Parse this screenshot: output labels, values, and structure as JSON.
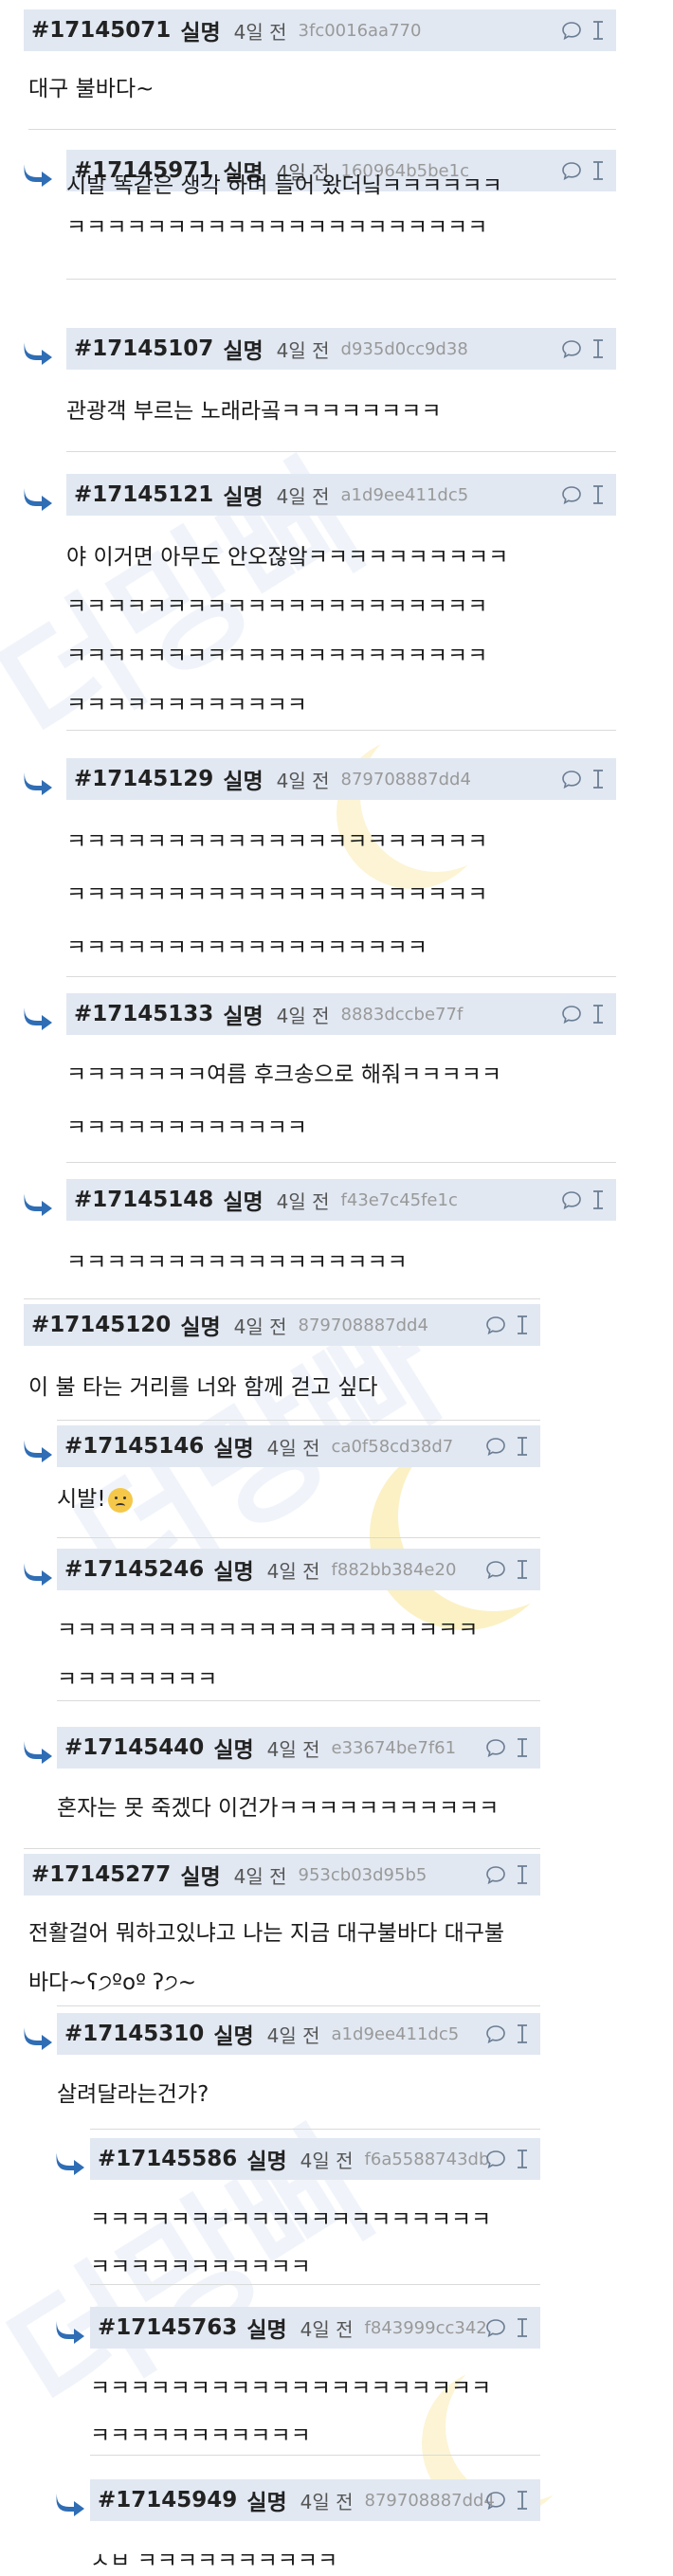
{
  "comments": [
    {
      "id": "#17145071",
      "author": "실명",
      "date": "4일 전",
      "hash": "3fc0016aa770",
      "lines": [
        "대구 불바다~"
      ]
    },
    {
      "id": "#17145971",
      "author": "실명",
      "date": "4일 전",
      "hash": "160964b5be1c",
      "lines": [
        "시발 똑같은 생각 하며 들어 왔더닠ㅋㅋㅋㅋㅋㅋ",
        "ㅋㅋㅋㅋㅋㅋㅋㅋㅋㅋㅋㅋㅋㅋㅋㅋㅋㅋㅋㅋㅋ"
      ]
    },
    {
      "id": "#17145107",
      "author": "실명",
      "date": "4일 전",
      "hash": "d935d0cc9d38",
      "lines": [
        "관광객 부르는 노래라곸ㅋㅋㅋㅋㅋㅋㅋㅋ"
      ]
    },
    {
      "id": "#17145121",
      "author": "실명",
      "date": "4일 전",
      "hash": "a1d9ee411dc5",
      "lines": [
        "야 이거면 아무도 안오잖앜ㅋㅋㅋㅋㅋㅋㅋㅋㅋㅋ",
        "ㅋㅋㅋㅋㅋㅋㅋㅋㅋㅋㅋㅋㅋㅋㅋㅋㅋㅋㅋㅋㅋ",
        "ㅋㅋㅋㅋㅋㅋㅋㅋㅋㅋㅋㅋㅋㅋㅋㅋㅋㅋㅋㅋㅋ",
        "ㅋㅋㅋㅋㅋㅋㅋㅋㅋㅋㅋㅋ"
      ]
    },
    {
      "id": "#17145129",
      "author": "실명",
      "date": "4일 전",
      "hash": "879708887dd4",
      "lines": [
        "ㅋㅋㅋㅋㅋㅋㅋㅋㅋㅋㅋㅋㅋㅋㅋㅋㅋㅋㅋㅋㅋ",
        "ㅋㅋㅋㅋㅋㅋㅋㅋㅋㅋㅋㅋㅋㅋㅋㅋㅋㅋㅋㅋㅋ",
        "ㅋㅋㅋㅋㅋㅋㅋㅋㅋㅋㅋㅋㅋㅋㅋㅋㅋㅋ"
      ]
    },
    {
      "id": "#17145133",
      "author": "실명",
      "date": "4일 전",
      "hash": "8883dccbe77f",
      "lines": [
        "ㅋㅋㅋㅋㅋㅋㅋ여름 후크송으로 해줘ㅋㅋㅋㅋㅋ",
        "ㅋㅋㅋㅋㅋㅋㅋㅋㅋㅋㅋㅋ"
      ]
    },
    {
      "id": "#17145148",
      "author": "실명",
      "date": "4일 전",
      "hash": "f43e7c45fe1c",
      "lines": [
        "ㅋㅋㅋㅋㅋㅋㅋㅋㅋㅋㅋㅋㅋㅋㅋㅋㅋ"
      ]
    },
    {
      "id": "#17145120",
      "author": "실명",
      "date": "4일 전",
      "hash": "879708887dd4",
      "lines": [
        "이 불 타는 거리를 너와 함께 걷고 싶다"
      ]
    },
    {
      "id": "#17145146",
      "author": "실명",
      "date": "4일 전",
      "hash": "ca0f58cd38d7",
      "lines": [
        "시발!"
      ]
    },
    {
      "id": "#17145246",
      "author": "실명",
      "date": "4일 전",
      "hash": "f882bb384e20",
      "lines": [
        "ㅋㅋㅋㅋㅋㅋㅋㅋㅋㅋㅋㅋㅋㅋㅋㅋㅋㅋㅋㅋㅋ",
        "ㅋㅋㅋㅋㅋㅋㅋㅋ"
      ]
    },
    {
      "id": "#17145440",
      "author": "실명",
      "date": "4일 전",
      "hash": "e33674be7f61",
      "lines": [
        "혼자는 못 죽겠다 이건가ㅋㅋㅋㅋㅋㅋㅋㅋㅋㅋㅋ"
      ]
    },
    {
      "id": "#17145277",
      "author": "실명",
      "date": "4일 전",
      "hash": "953cb03d95b5",
      "lines": [
        "전활걸어 뭐하고있냐고 나는 지금 대구불바다 대구불",
        "바다~ʕ੭ºoº ʔ੭~"
      ]
    },
    {
      "id": "#17145310",
      "author": "실명",
      "date": "4일 전",
      "hash": "a1d9ee411dc5",
      "lines": [
        "살려달라는건가?"
      ]
    },
    {
      "id": "#17145586",
      "author": "실명",
      "date": "4일 전",
      "hash": "f6a5588743db",
      "lines": [
        "ㅋㅋㅋㅋㅋㅋㅋㅋㅋㅋㅋㅋㅋㅋㅋㅋㅋㅋㅋㅋ",
        "ㅋㅋㅋㅋㅋㅋㅋㅋㅋㅋㅋ"
      ]
    },
    {
      "id": "#17145763",
      "author": "실명",
      "date": "4일 전",
      "hash": "f843999cc342",
      "lines": [
        "ㅋㅋㅋㅋㅋㅋㅋㅋㅋㅋㅋㅋㅋㅋㅋㅋㅋㅋㅋㅋ",
        "ㅋㅋㅋㅋㅋㅋㅋㅋㅋㅋㅋ"
      ]
    },
    {
      "id": "#17145949",
      "author": "실명",
      "date": "4일 전",
      "hash": "879708887dd4",
      "lines": [
        "ㅅㅂ ㅋㅋㅋㅋㅋㅋㅋㅋㅋㅋ"
      ]
    }
  ],
  "watermark": "더망빠",
  "icons": {
    "reply": "reply-arrow-icon",
    "comment": "chat-bubble-icon",
    "report": "text-cursor-icon"
  },
  "colors": {
    "header_bg": "#e1e8f2",
    "arrow": "#2f6db5",
    "text": "#1a1a1a",
    "hash": "#999999"
  }
}
